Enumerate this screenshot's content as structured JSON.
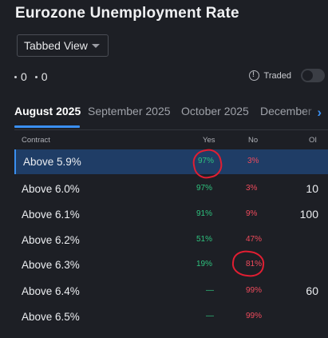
{
  "page": {
    "title": "Eurozone Unemployment Rate"
  },
  "view_select": {
    "value": "Tabbed View"
  },
  "counts": [
    {
      "value": "0"
    },
    {
      "value": "0"
    }
  ],
  "traded": {
    "label": "Traded",
    "enabled": false
  },
  "tabs": [
    {
      "label": "August 2025",
      "active": true
    },
    {
      "label": "September 2025",
      "active": false
    },
    {
      "label": "October 2025",
      "active": false
    },
    {
      "label": "December",
      "active": false
    }
  ],
  "table": {
    "headers": {
      "contract": "Contract",
      "yes": "Yes",
      "no": "No",
      "oi": "OI"
    },
    "rows": [
      {
        "contract": "Above 5.9%",
        "yes": "97%",
        "no": "3%",
        "oi": "",
        "selected": true
      },
      {
        "contract": "Above 6.0%",
        "yes": "97%",
        "no": "3%",
        "oi": "10",
        "selected": false
      },
      {
        "contract": "Above 6.1%",
        "yes": "91%",
        "no": "9%",
        "oi": "100",
        "selected": false
      },
      {
        "contract": "Above 6.2%",
        "yes": "51%",
        "no": "47%",
        "oi": "",
        "selected": false
      },
      {
        "contract": "Above 6.3%",
        "yes": "19%",
        "no": "81%",
        "oi": "",
        "selected": false
      },
      {
        "contract": "Above 6.4%",
        "yes": "—",
        "no": "99%",
        "oi": "60",
        "selected": false
      },
      {
        "contract": "Above 6.5%",
        "yes": "—",
        "no": "99%",
        "oi": "",
        "selected": false
      }
    ]
  },
  "colors": {
    "accent": "#3a8ff0",
    "yes": "#2ec27e",
    "no": "#ef4b5c",
    "annotation": "#e01e32"
  }
}
